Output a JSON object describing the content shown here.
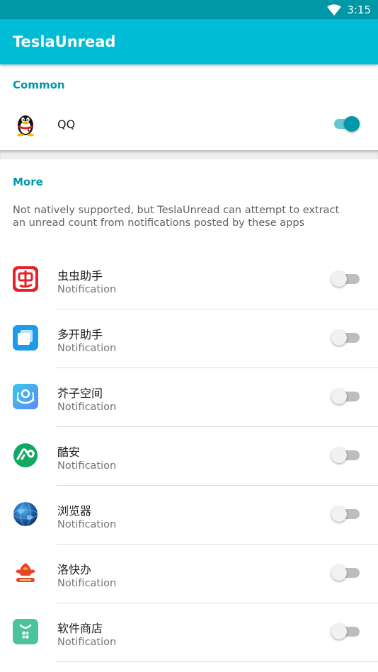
{
  "status_bar": {
    "time": "3:15"
  },
  "app_bar": {
    "title": "TeslaUnread"
  },
  "common": {
    "header": "Common",
    "items": [
      {
        "label": "QQ",
        "icon": "qq-penguin-icon",
        "enabled": true
      }
    ]
  },
  "more": {
    "header": "More",
    "description": "Not natively supported, but TeslaUnread can attempt to extract an unread count from notifications posted by these apps",
    "items": [
      {
        "name": "虫虫助手",
        "sub": "Notification",
        "icon": "chongchong-icon",
        "enabled": false
      },
      {
        "name": "多开助手",
        "sub": "Notification",
        "icon": "duokai-icon",
        "enabled": false
      },
      {
        "name": "芥子空间",
        "sub": "Notification",
        "icon": "jiezi-icon",
        "enabled": false
      },
      {
        "name": "酷安",
        "sub": "Notification",
        "icon": "coolapk-icon",
        "enabled": false
      },
      {
        "name": "浏览器",
        "sub": "Notification",
        "icon": "browser-globe-icon",
        "enabled": false
      },
      {
        "name": "洛快办",
        "sub": "Notification",
        "icon": "luokuaiban-icon",
        "enabled": false
      },
      {
        "name": "软件商店",
        "sub": "Notification",
        "icon": "app-store-icon",
        "enabled": false
      }
    ]
  },
  "colors": {
    "primary": "#00bcd4",
    "primary_dark": "#0097a7",
    "accent": "#0097a7"
  }
}
